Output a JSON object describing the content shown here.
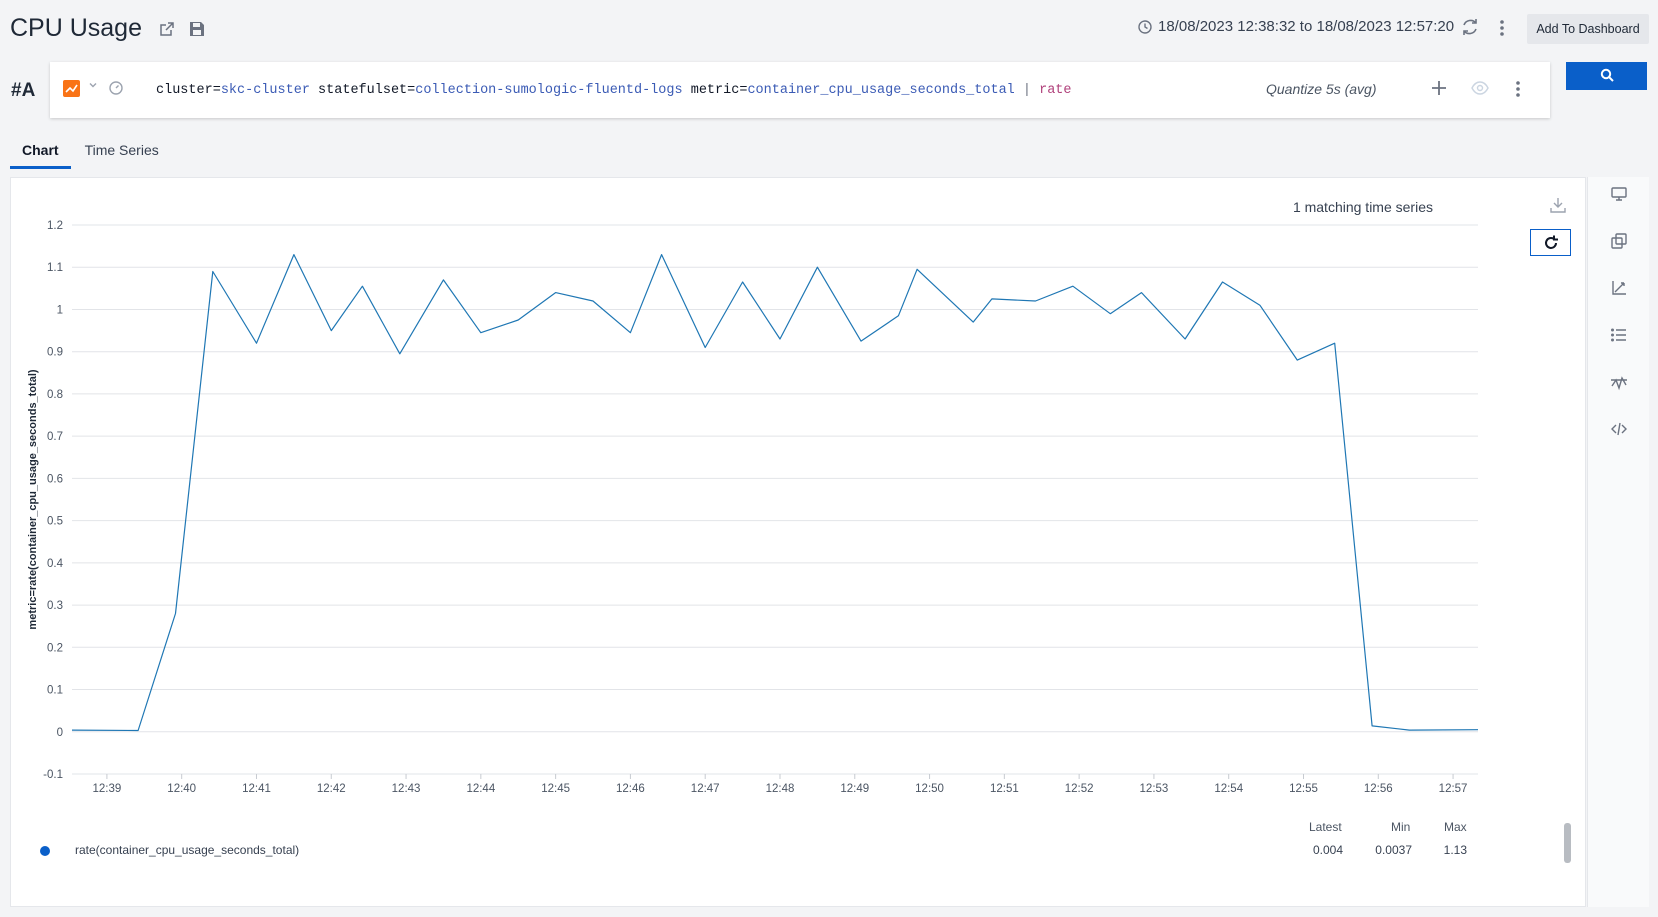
{
  "header": {
    "title": "CPU Usage",
    "time_range": "18/08/2023 12:38:32 to 18/08/2023 12:57:20",
    "add_to_dashboard": "Add To Dashboard",
    "icons": [
      "share-icon",
      "save-icon",
      "clock-icon",
      "refresh-icon",
      "kebab-menu-icon"
    ]
  },
  "query": {
    "label": "#A",
    "parts": [
      {
        "key": "cluster=",
        "value": "skc-cluster"
      },
      {
        "key": "statefulset=",
        "value": "collection-sumologic-fluentd-logs"
      },
      {
        "key": "metric=",
        "value": "container_cpu_usage_seconds_total"
      }
    ],
    "pipe": "|",
    "operator": "rate",
    "quantize": "Quantize 5s (avg)",
    "accent_color": "#f97316"
  },
  "tabs": [
    {
      "label": "Chart",
      "active": true
    },
    {
      "label": "Time Series",
      "active": false
    }
  ],
  "chart": {
    "matching": "1 matching time series"
  },
  "chart_data": {
    "type": "line",
    "title": "",
    "xlabel": "",
    "ylabel": "metric=rate(container_cpu_usage_seconds_total)",
    "ylim": [
      -0.1,
      1.2
    ],
    "xlim": [
      "12:38:32",
      "12:57:20"
    ],
    "y_ticks": [
      -0.1,
      0,
      0.1,
      0.2,
      0.3,
      0.4,
      0.5,
      0.6,
      0.7,
      0.8,
      0.9,
      1,
      1.1,
      1.2
    ],
    "x_ticks": [
      "12:39",
      "12:40",
      "12:41",
      "12:42",
      "12:43",
      "12:44",
      "12:45",
      "12:46",
      "12:47",
      "12:48",
      "12:49",
      "12:50",
      "12:51",
      "12:52",
      "12:53",
      "12:54",
      "12:55",
      "12:56",
      "12:57"
    ],
    "grid": true,
    "series": [
      {
        "name": "rate(container_cpu_usage_seconds_total)",
        "color": "#1f77b4",
        "points": [
          [
            "12:38:32",
            0.004
          ],
          [
            "12:39:25",
            0.003
          ],
          [
            "12:39:55",
            0.28
          ],
          [
            "12:40:25",
            1.09
          ],
          [
            "12:41:00",
            0.92
          ],
          [
            "12:41:30",
            1.13
          ],
          [
            "12:42:00",
            0.95
          ],
          [
            "12:42:25",
            1.055
          ],
          [
            "12:42:55",
            0.895
          ],
          [
            "12:43:30",
            1.07
          ],
          [
            "12:44:00",
            0.945
          ],
          [
            "12:44:30",
            0.975
          ],
          [
            "12:45:00",
            1.04
          ],
          [
            "12:45:30",
            1.02
          ],
          [
            "12:46:00",
            0.945
          ],
          [
            "12:46:25",
            1.13
          ],
          [
            "12:47:00",
            0.91
          ],
          [
            "12:47:30",
            1.065
          ],
          [
            "12:48:00",
            0.93
          ],
          [
            "12:48:30",
            1.1
          ],
          [
            "12:49:05",
            0.925
          ],
          [
            "12:49:35",
            0.985
          ],
          [
            "12:49:50",
            1.095
          ],
          [
            "12:50:35",
            0.97
          ],
          [
            "12:50:50",
            1.025
          ],
          [
            "12:51:25",
            1.02
          ],
          [
            "12:51:55",
            1.055
          ],
          [
            "12:52:25",
            0.99
          ],
          [
            "12:52:50",
            1.04
          ],
          [
            "12:53:25",
            0.93
          ],
          [
            "12:53:55",
            1.065
          ],
          [
            "12:54:25",
            1.01
          ],
          [
            "12:54:55",
            0.88
          ],
          [
            "12:55:25",
            0.92
          ],
          [
            "12:55:55",
            0.014
          ],
          [
            "12:56:25",
            0.004
          ],
          [
            "12:57:20",
            0.005
          ]
        ]
      }
    ]
  },
  "legend": {
    "headers": [
      "Latest",
      "Min",
      "Max"
    ],
    "series_name": "rate(container_cpu_usage_seconds_total)",
    "latest": "0.004",
    "min": "0.0037",
    "max": "1.13"
  },
  "side_rail": {
    "icons": [
      "display-icon",
      "copy-icon",
      "axis-icon",
      "list-icon",
      "threshold-icon",
      "code-icon"
    ]
  }
}
